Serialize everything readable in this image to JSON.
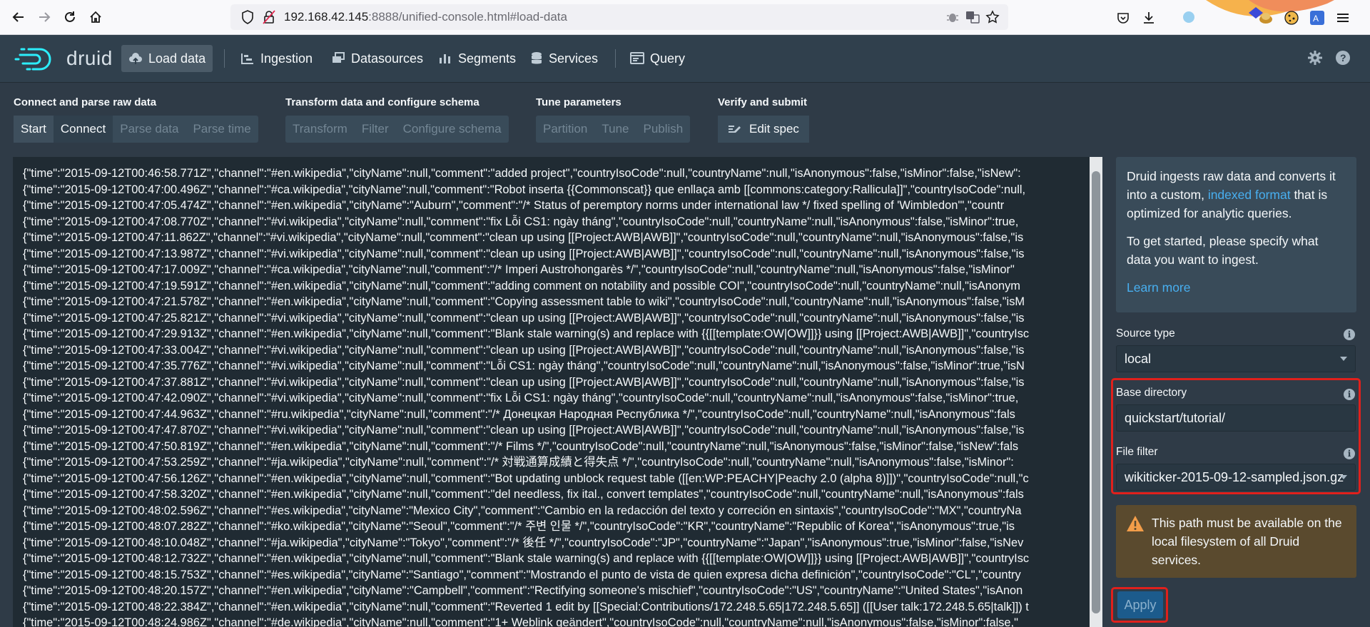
{
  "browser": {
    "url_host": "192.168.42.145",
    "url_rest": ":8888/unified-console.html#load-data"
  },
  "header": {
    "logo_text": "druid",
    "nav": [
      {
        "label": "Load data",
        "icon": "cloud-upload-icon",
        "active": true
      },
      {
        "label": "Ingestion",
        "icon": "gantt-chart-icon"
      },
      {
        "label": "Datasources",
        "icon": "multi-select-icon"
      },
      {
        "label": "Segments",
        "icon": "stacked-chart-icon"
      },
      {
        "label": "Services",
        "icon": "database-icon"
      },
      {
        "label": "Query",
        "icon": "application-icon"
      }
    ]
  },
  "steps": {
    "groups": [
      {
        "title": "Connect and parse raw data",
        "items": [
          "Start",
          "Connect",
          "Parse data",
          "Parse time"
        ]
      },
      {
        "title": "Transform data and configure schema",
        "items": [
          "Transform",
          "Filter",
          "Configure schema"
        ]
      },
      {
        "title": "Tune parameters",
        "items": [
          "Partition",
          "Tune",
          "Publish"
        ]
      },
      {
        "title": "Verify and submit",
        "items": [
          "Edit spec"
        ]
      }
    ]
  },
  "raw_data": [
    "{\"time\":\"2015-09-12T00:46:58.771Z\",\"channel\":\"#en.wikipedia\",\"cityName\":null,\"comment\":\"added project\",\"countryIsoCode\":null,\"countryName\":null,\"isAnonymous\":false,\"isMinor\":false,\"isNew\":",
    "{\"time\":\"2015-09-12T00:47:00.496Z\",\"channel\":\"#ca.wikipedia\",\"cityName\":null,\"comment\":\"Robot inserta {{Commonscat}} que enllaça amb [[commons:category:Rallicula]]\",\"countryIsoCode\":null,",
    "{\"time\":\"2015-09-12T00:47:05.474Z\",\"channel\":\"#en.wikipedia\",\"cityName\":\"Auburn\",\"comment\":\"/* Status of peremptory norms under international law */ fixed spelling of 'Wimbledon'\",\"countr",
    "{\"time\":\"2015-09-12T00:47:08.770Z\",\"channel\":\"#vi.wikipedia\",\"cityName\":null,\"comment\":\"fix Lỗi CS1: ngày tháng\",\"countryIsoCode\":null,\"countryName\":null,\"isAnonymous\":false,\"isMinor\":true,",
    "{\"time\":\"2015-09-12T00:47:11.862Z\",\"channel\":\"#vi.wikipedia\",\"cityName\":null,\"comment\":\"clean up using [[Project:AWB|AWB]]\",\"countryIsoCode\":null,\"countryName\":null,\"isAnonymous\":false,\"is",
    "{\"time\":\"2015-09-12T00:47:13.987Z\",\"channel\":\"#vi.wikipedia\",\"cityName\":null,\"comment\":\"clean up using [[Project:AWB|AWB]]\",\"countryIsoCode\":null,\"countryName\":null,\"isAnonymous\":false,\"is",
    "{\"time\":\"2015-09-12T00:47:17.009Z\",\"channel\":\"#ca.wikipedia\",\"cityName\":null,\"comment\":\"/* Imperi Austrohongarès */\",\"countryIsoCode\":null,\"countryName\":null,\"isAnonymous\":false,\"isMinor\"",
    "{\"time\":\"2015-09-12T00:47:19.591Z\",\"channel\":\"#en.wikipedia\",\"cityName\":null,\"comment\":\"adding comment on notability and possible COI\",\"countryIsoCode\":null,\"countryName\":null,\"isAnonym",
    "{\"time\":\"2015-09-12T00:47:21.578Z\",\"channel\":\"#en.wikipedia\",\"cityName\":null,\"comment\":\"Copying assessment table to wiki\",\"countryIsoCode\":null,\"countryName\":null,\"isAnonymous\":false,\"isM",
    "{\"time\":\"2015-09-12T00:47:25.821Z\",\"channel\":\"#vi.wikipedia\",\"cityName\":null,\"comment\":\"clean up using [[Project:AWB|AWB]]\",\"countryIsoCode\":null,\"countryName\":null,\"isAnonymous\":false,\"is",
    "{\"time\":\"2015-09-12T00:47:29.913Z\",\"channel\":\"#en.wikipedia\",\"cityName\":null,\"comment\":\"Blank stale warning(s) and replace with {{[[template:OW|OW]]}} using [[Project:AWB|AWB]]\",\"countryIsc",
    "{\"time\":\"2015-09-12T00:47:33.004Z\",\"channel\":\"#vi.wikipedia\",\"cityName\":null,\"comment\":\"clean up using [[Project:AWB|AWB]]\",\"countryIsoCode\":null,\"countryName\":null,\"isAnonymous\":false,\"is",
    "{\"time\":\"2015-09-12T00:47:35.776Z\",\"channel\":\"#vi.wikipedia\",\"cityName\":null,\"comment\":\"Lỗi CS1: ngày tháng\",\"countryIsoCode\":null,\"countryName\":null,\"isAnonymous\":false,\"isMinor\":true,\"isN",
    "{\"time\":\"2015-09-12T00:47:37.881Z\",\"channel\":\"#vi.wikipedia\",\"cityName\":null,\"comment\":\"clean up using [[Project:AWB|AWB]]\",\"countryIsoCode\":null,\"countryName\":null,\"isAnonymous\":false,\"is",
    "{\"time\":\"2015-09-12T00:47:42.090Z\",\"channel\":\"#vi.wikipedia\",\"cityName\":null,\"comment\":\"fix Lỗi CS1: ngày tháng\",\"countryIsoCode\":null,\"countryName\":null,\"isAnonymous\":false,\"isMinor\":true,",
    "{\"time\":\"2015-09-12T00:47:44.963Z\",\"channel\":\"#ru.wikipedia\",\"cityName\":null,\"comment\":\"/* Донецкая Народная Республика */\",\"countryIsoCode\":null,\"countryName\":null,\"isAnonymous\":fals",
    "{\"time\":\"2015-09-12T00:47:47.870Z\",\"channel\":\"#vi.wikipedia\",\"cityName\":null,\"comment\":\"clean up using [[Project:AWB|AWB]]\",\"countryIsoCode\":null,\"countryName\":null,\"isAnonymous\":false,\"is",
    "{\"time\":\"2015-09-12T00:47:50.819Z\",\"channel\":\"#en.wikipedia\",\"cityName\":null,\"comment\":\"/* Films */\",\"countryIsoCode\":null,\"countryName\":null,\"isAnonymous\":false,\"isMinor\":false,\"isNew\":fals",
    "{\"time\":\"2015-09-12T00:47:53.259Z\",\"channel\":\"#ja.wikipedia\",\"cityName\":null,\"comment\":\"/* 対戦通算成績と得失点 */\",\"countryIsoCode\":null,\"countryName\":null,\"isAnonymous\":false,\"isMinor\":",
    "{\"time\":\"2015-09-12T00:47:56.126Z\",\"channel\":\"#en.wikipedia\",\"cityName\":null,\"comment\":\"Bot updating unblock request table ([[en:WP:PEACHY|Peachy 2.0 (alpha 8)]])\",\"countryIsoCode\":null,\"c",
    "{\"time\":\"2015-09-12T00:47:58.320Z\",\"channel\":\"#en.wikipedia\",\"cityName\":null,\"comment\":\"del needless, fix ital., convert templates\",\"countryIsoCode\":null,\"countryName\":null,\"isAnonymous\":fals",
    "{\"time\":\"2015-09-12T00:48:02.596Z\",\"channel\":\"#es.wikipedia\",\"cityName\":\"Mexico City\",\"comment\":\"Cambio en la redacción del texto y correción en sintaxis\",\"countryIsoCode\":\"MX\",\"countryNa",
    "{\"time\":\"2015-09-12T00:48:07.282Z\",\"channel\":\"#ko.wikipedia\",\"cityName\":\"Seoul\",\"comment\":\"/* 주변 인물 */\",\"countryIsoCode\":\"KR\",\"countryName\":\"Republic of Korea\",\"isAnonymous\":true,\"is",
    "{\"time\":\"2015-09-12T00:48:10.048Z\",\"channel\":\"#ja.wikipedia\",\"cityName\":\"Tokyo\",\"comment\":\"/* 後任 */\",\"countryIsoCode\":\"JP\",\"countryName\":\"Japan\",\"isAnonymous\":true,\"isMinor\":false,\"isNev",
    "{\"time\":\"2015-09-12T00:48:12.732Z\",\"channel\":\"#en.wikipedia\",\"cityName\":null,\"comment\":\"Blank stale warning(s) and replace with {{[[template:OW|OW]]}} using [[Project:AWB|AWB]]\",\"countryIsc",
    "{\"time\":\"2015-09-12T00:48:15.753Z\",\"channel\":\"#es.wikipedia\",\"cityName\":\"Santiago\",\"comment\":\"Mostrando el punto de vista de quien expresa dicha definición\",\"countryIsoCode\":\"CL\",\"country",
    "{\"time\":\"2015-09-12T00:48:20.157Z\",\"channel\":\"#en.wikipedia\",\"cityName\":\"Campbell\",\"comment\":\"Rectifying someone's mischief\",\"countryIsoCode\":\"US\",\"countryName\":\"United States\",\"isAnon",
    "{\"time\":\"2015-09-12T00:48:22.384Z\",\"channel\":\"#en.wikipedia\",\"cityName\":null,\"comment\":\"Reverted 1 edit by [[Special:Contributions/172.248.5.65|172.248.5.65]] ([[User talk:172.248.5.65|talk]]) t",
    "{\"time\":\"2015-09-12T00:48:24.986Z\",\"channel\":\"#de.wikipedia\",\"cityName\":null,\"comment\":\"1+ Weblink geändert\",\"countryIsoCode\":null,\"countryName\":null,\"isAnonymous\":false,\"isMinor\":false,\""
  ],
  "sidebar": {
    "intro_1": "Druid ingests raw data and converts it into a custom, ",
    "intro_link": "indexed format",
    "intro_1_end": " that is optimized for analytic queries.",
    "intro_2": "To get started, please specify what data you want to ingest.",
    "learn_more": "Learn more",
    "source_type_label": "Source type",
    "source_type_value": "local",
    "base_dir_label": "Base directory",
    "base_dir_value": "quickstart/tutorial/",
    "file_filter_label": "File filter",
    "file_filter_value": "wikiticker-2015-09-12-sampled.json.gz",
    "warning": "This path must be available on the local filesystem of all Druid services.",
    "apply_label": "Apply"
  },
  "colors": {
    "accent": "#48aff0",
    "highlight": "#e0201c",
    "primary_button": "#1c5b8c"
  }
}
